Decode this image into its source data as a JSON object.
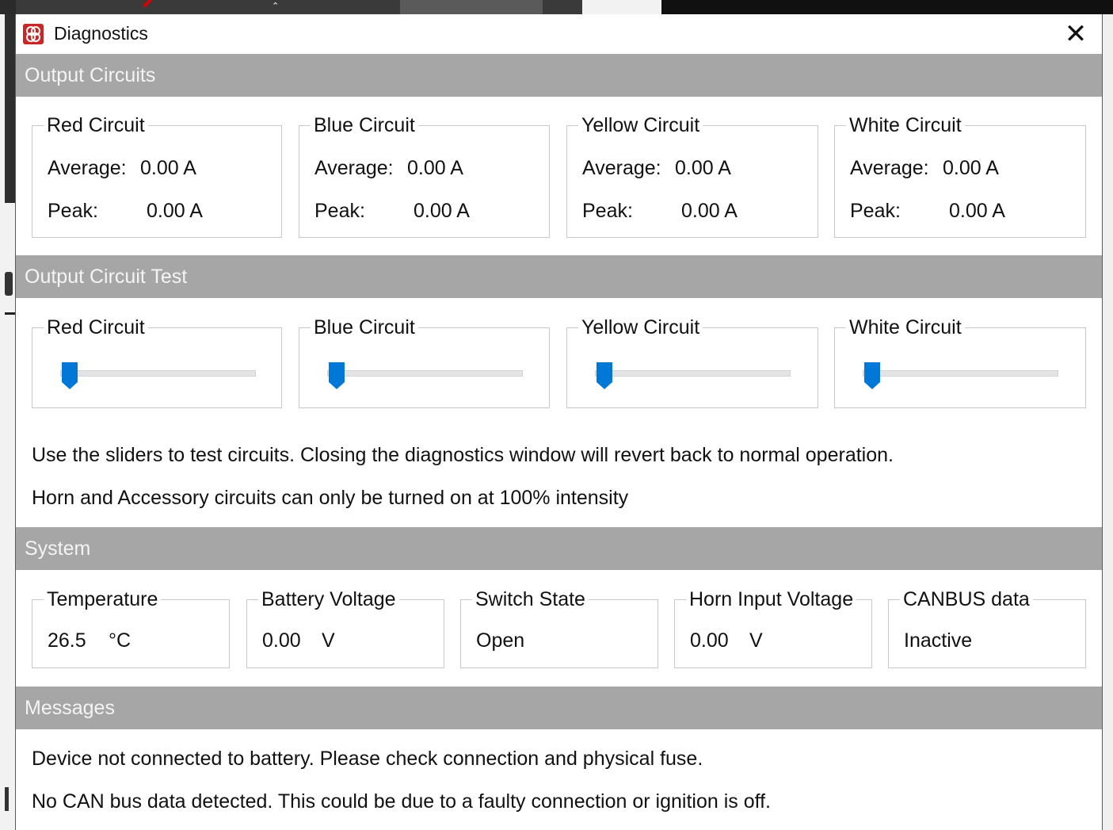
{
  "window": {
    "title": "Diagnostics",
    "close_glyph": "✕"
  },
  "sections": {
    "output_circuits": "Output Circuits",
    "output_circuit_test": "Output Circuit Test",
    "system": "System",
    "messages": "Messages"
  },
  "output_circuits": [
    {
      "name": "Red Circuit",
      "average_label": "Average:",
      "average_value": "0.00 A",
      "peak_label": "Peak:",
      "peak_value": "0.00 A"
    },
    {
      "name": "Blue Circuit",
      "average_label": "Average:",
      "average_value": "0.00 A",
      "peak_label": "Peak:",
      "peak_value": "0.00 A"
    },
    {
      "name": "Yellow Circuit",
      "average_label": "Average:",
      "average_value": "0.00 A",
      "peak_label": "Peak:",
      "peak_value": "0.00 A"
    },
    {
      "name": "White Circuit",
      "average_label": "Average:",
      "average_value": "0.00 A",
      "peak_label": "Peak:",
      "peak_value": "0.00 A"
    }
  ],
  "test_sliders": [
    {
      "name": "Red Circuit",
      "level": 0
    },
    {
      "name": "Blue Circuit",
      "level": 0
    },
    {
      "name": "Yellow Circuit",
      "level": 0
    },
    {
      "name": "White Circuit",
      "level": 0
    }
  ],
  "test_notes": {
    "line1": "Use the sliders to test circuits. Closing the diagnostics window will revert back to normal operation.",
    "line2": "Horn and Accessory circuits can only be turned on at 100% intensity"
  },
  "system": {
    "temperature": {
      "label": "Temperature",
      "value": "26.5",
      "unit": "°C"
    },
    "battery_voltage": {
      "label": "Battery Voltage",
      "value": "0.00",
      "unit": "V"
    },
    "switch_state": {
      "label": "Switch State",
      "value": "Open"
    },
    "horn_input_voltage": {
      "label": "Horn Input Voltage",
      "value": "0.00",
      "unit": "V"
    },
    "canbus": {
      "label": "CANBUS data",
      "value": "Inactive"
    }
  },
  "messages": [
    "Device not connected to battery. Please check connection and physical fuse.",
    "No CAN bus data detected. This could be due to a faulty connection or ignition is off."
  ],
  "colors": {
    "accent": "#0078d7",
    "section_header_bg": "#a6a6a6",
    "app_icon": "#c62828"
  }
}
